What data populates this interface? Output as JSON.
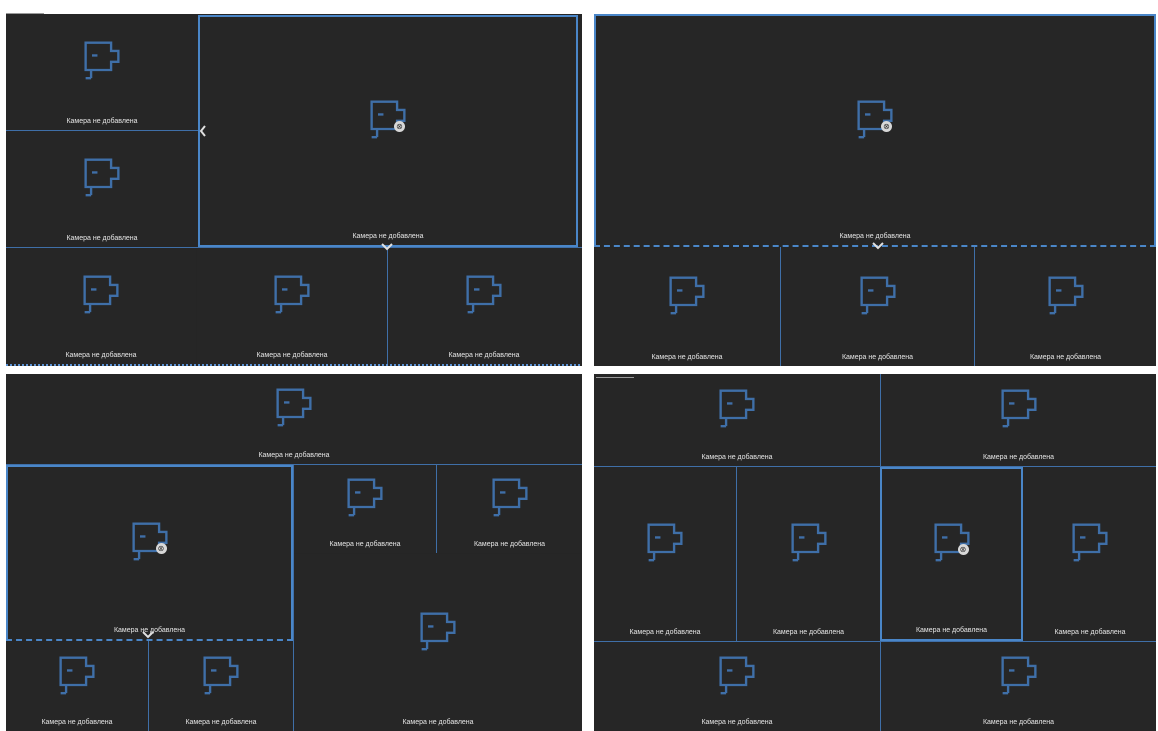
{
  "placeholder": {
    "label": "Камера не добавлена",
    "camera_icon": "camera-icon",
    "remove_icon": "remove-camera-icon",
    "remove_glyph": "⊗"
  },
  "colors": {
    "background": "#252525",
    "cell": "#262626",
    "divider": "#3f6fa8",
    "selection": "#4a86c8",
    "icon": "#3f6fa8",
    "text": "#e6e6e6"
  },
  "layouts": [
    {
      "name": "layout-top-left",
      "cameras": 6,
      "selected_index": 2
    },
    {
      "name": "layout-top-right",
      "cameras": 4,
      "selected_index": 0
    },
    {
      "name": "layout-bottom-left",
      "cameras": 7,
      "selected_index": 1
    },
    {
      "name": "layout-bottom-right",
      "cameras": 8,
      "selected_index": 4
    }
  ]
}
